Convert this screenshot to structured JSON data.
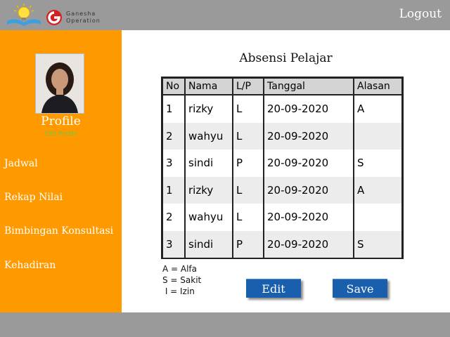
{
  "header": {
    "brand_line1": "Ganesha",
    "brand_line2": "Operation",
    "logout_label": "Logout"
  },
  "sidebar": {
    "profile_title": "Profile",
    "edit_profile_label": "Edit Profile",
    "items": [
      {
        "label": "Jadwal"
      },
      {
        "label": "Rekap Nilai"
      },
      {
        "label": "Bimbingan Konsultasi"
      },
      {
        "label": "Kehadiran"
      }
    ]
  },
  "main": {
    "title": "Absensi Pelajar",
    "table": {
      "headers": [
        "No",
        "Nama",
        "L/P",
        "Tanggal",
        "Alasan"
      ],
      "rows": [
        {
          "no": "1",
          "nama": "rizky",
          "lp": "L",
          "tanggal": "20-09-2020",
          "alasan": "A"
        },
        {
          "no": "2",
          "nama": "wahyu",
          "lp": "L",
          "tanggal": "20-09-2020",
          "alasan": ""
        },
        {
          "no": "3",
          "nama": "sindi",
          "lp": "P",
          "tanggal": "20-09-2020",
          "alasan": "S"
        },
        {
          "no": "1",
          "nama": "rizky",
          "lp": "L",
          "tanggal": "20-09-2020",
          "alasan": "A"
        },
        {
          "no": "2",
          "nama": "wahyu",
          "lp": "L",
          "tanggal": "20-09-2020",
          "alasan": ""
        },
        {
          "no": "3",
          "nama": "sindi",
          "lp": "P",
          "tanggal": "20-09-2020",
          "alasan": "S"
        }
      ]
    },
    "legend": [
      "A = Alfa",
      "S = Sakit",
      " I = Izin"
    ],
    "edit_label": "Edit",
    "save_label": "Save"
  },
  "colors": {
    "topbar": "#9a9a9a",
    "sidebar": "#ff9900",
    "button": "#1a5fad",
    "edit_profile_text": "#66cc44"
  }
}
